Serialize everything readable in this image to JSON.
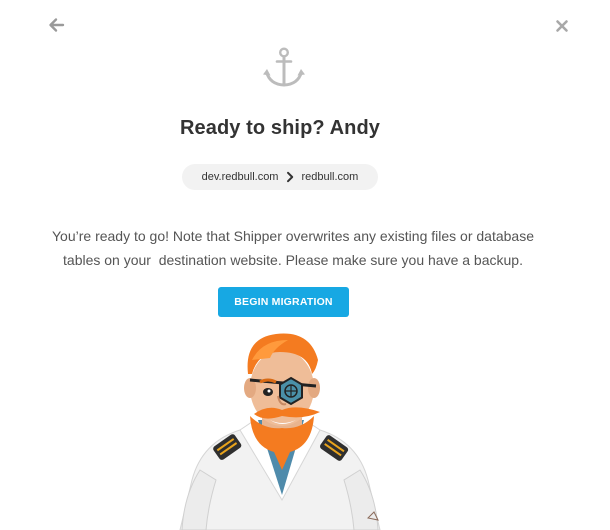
{
  "header": {
    "back_icon": "arrow-left-icon",
    "close_icon": "close-icon"
  },
  "hero": {
    "icon": "anchor-icon",
    "title": "Ready to ship? Andy"
  },
  "route": {
    "source": "dev.redbull.com",
    "separator_icon": "chevron-right-icon",
    "destination": "redbull.com"
  },
  "message": {
    "line1": "You’re ready to go! Note that Shipper overwrites any existing files or database",
    "line2": "tables on your  destination website. Please make sure you have a backup."
  },
  "actions": {
    "begin_label": "BEGIN MIGRATION"
  },
  "illustration": {
    "name": "pirate-captain-mascot"
  },
  "colors": {
    "accent": "#17a8e3",
    "icon_gray": "#a8a8a8",
    "title": "#333333",
    "body_text": "#555555",
    "pill_bg": "#f2f2f2",
    "hair_orange": "#f47b20"
  }
}
